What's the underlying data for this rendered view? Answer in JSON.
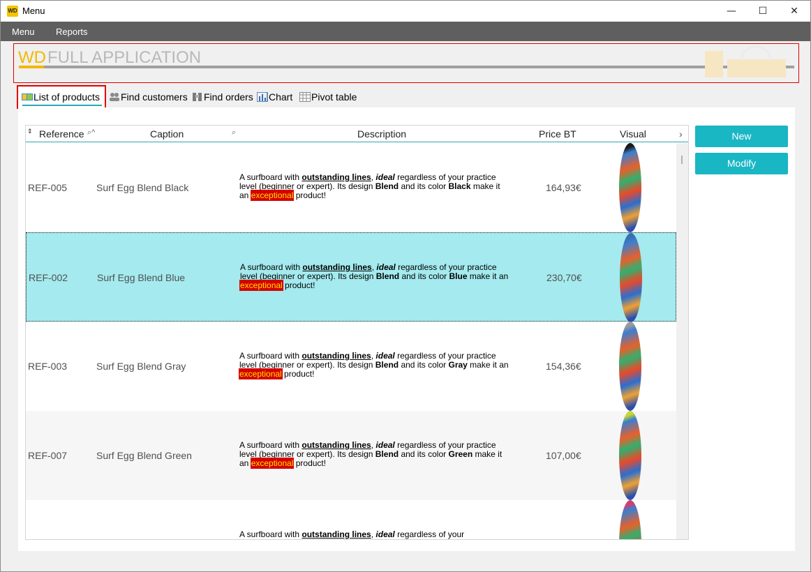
{
  "window": {
    "title": "Menu",
    "logo_text": "WD",
    "controls": {
      "minimize": "—",
      "maximize": "☐",
      "close": "✕"
    }
  },
  "menubar": {
    "items": [
      "Menu",
      "Reports"
    ]
  },
  "banner": {
    "brand": "WD",
    "title": "FULL APPLICATION"
  },
  "tabs": [
    {
      "label": "List of products",
      "icon": "list-icon",
      "active": true
    },
    {
      "label": "Find customers",
      "icon": "customers-icon",
      "active": false
    },
    {
      "label": "Find orders",
      "icon": "orders-icon",
      "active": false
    },
    {
      "label": "Chart",
      "icon": "chart-icon",
      "active": false
    },
    {
      "label": "Pivot table",
      "icon": "pivot-table-icon",
      "active": false
    }
  ],
  "table": {
    "columns": {
      "reference": "Reference",
      "caption": "Caption",
      "description": "Description",
      "price": "Price BT",
      "visual": "Visual"
    },
    "rows": [
      {
        "reference": "REF-005",
        "caption": "Surf Egg Blend Black",
        "color": "Black",
        "price": "164,93€",
        "selected": false
      },
      {
        "reference": "REF-002",
        "caption": "Surf Egg Blend Blue",
        "color": "Blue",
        "price": "230,70€",
        "selected": true
      },
      {
        "reference": "REF-003",
        "caption": "Surf Egg Blend Gray",
        "color": "Gray",
        "price": "154,36€",
        "selected": false
      },
      {
        "reference": "REF-007",
        "caption": "Surf Egg Blend Green",
        "color": "Green",
        "price": "107,00€",
        "selected": false
      },
      {
        "reference": "",
        "caption": "",
        "color": "",
        "price": "",
        "selected": false
      }
    ],
    "description_parts": {
      "p1": "A surfboard with ",
      "lines": "outstanding lines",
      "p2": ", ",
      "ideal": "ideal",
      "p3": " regardless of your practice level (beginner or expert). Its design ",
      "blend": "Blend",
      "p4": " and its color ",
      "p5": " make it an ",
      "exceptional": "exceptional",
      "p6": " product!"
    },
    "board_tips": [
      "#1a1a1a",
      "#3a6fb0",
      "#9a9a9a",
      "#c8d830",
      "#d04070"
    ]
  },
  "buttons": {
    "new": "New",
    "modify": "Modify"
  },
  "colors": {
    "accent": "#19b6c4",
    "highlight": "#a4eaee",
    "brand_yellow": "#f2b800",
    "menubar": "#5f5f5f"
  }
}
